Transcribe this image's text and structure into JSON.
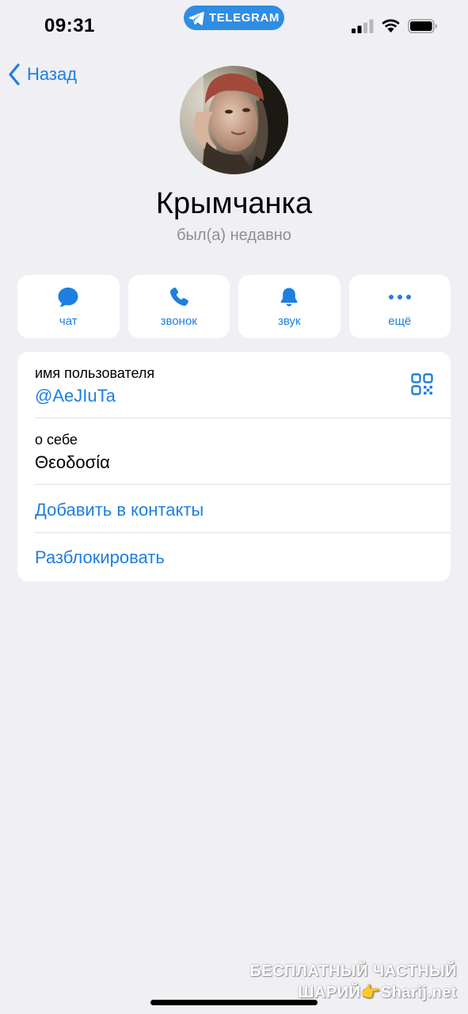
{
  "status_bar": {
    "time": "09:31",
    "app_pill": "TELEGRAM",
    "icons": [
      "signal-icon",
      "wifi-icon",
      "battery-icon"
    ]
  },
  "nav": {
    "back_label": "Назад"
  },
  "profile": {
    "name": "Крымчанка",
    "last_seen": "был(а) недавно"
  },
  "actions": [
    {
      "label": "чат",
      "icon": "chat-icon"
    },
    {
      "label": "звонок",
      "icon": "phone-icon"
    },
    {
      "label": "звук",
      "icon": "bell-icon"
    },
    {
      "label": "ещё",
      "icon": "more-icon"
    }
  ],
  "info": {
    "username_label": "имя пользователя",
    "username_value": "@AeJIuTa",
    "bio_label": "о себе",
    "bio_value": "Θεοδοσία",
    "add_contact": "Добавить в контакты",
    "unblock": "Разблокировать"
  },
  "watermark": {
    "line1": "БЕСПЛАТНЫЙ ЧАСТНЫЙ",
    "line2": "ШАРИЙ👉Sharij.net"
  },
  "colors": {
    "accent": "#1d7fe0",
    "background": "#efeff4",
    "secondary_text": "#8e8e93"
  }
}
